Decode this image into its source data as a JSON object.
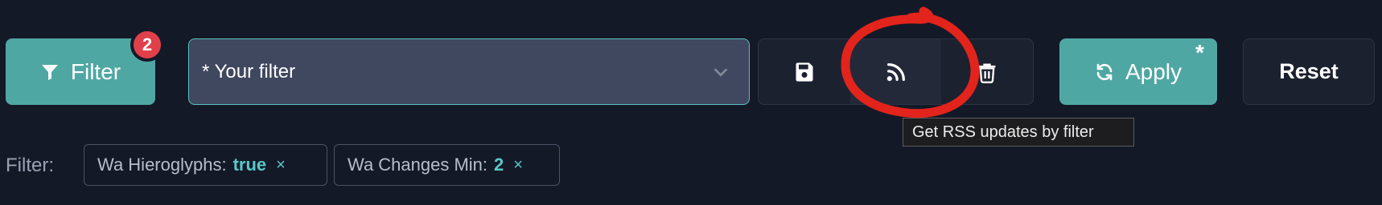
{
  "toolbar": {
    "filter_button": {
      "label": "Filter",
      "icon": "filter-funnel-icon",
      "badge_count": "2"
    },
    "filter_select": {
      "value": "* Your filter",
      "icon": "chevron-down-icon"
    },
    "actions": [
      {
        "name": "save",
        "icon": "floppy-disk-icon"
      },
      {
        "name": "rss",
        "icon": "rss-feed-icon"
      },
      {
        "name": "delete",
        "icon": "trash-icon"
      }
    ],
    "apply_button": {
      "label": "Apply",
      "icon": "refresh-icon",
      "modified_marker": "*"
    },
    "reset_button": {
      "label": "Reset"
    }
  },
  "tooltip": {
    "text": "Get RSS updates by filter"
  },
  "active_filters": {
    "label": "Filter:",
    "chips": [
      {
        "key": "Wa Hieroglyphs:",
        "value": "true",
        "remove": "×"
      },
      {
        "key": "Wa Changes Min:",
        "value": "2",
        "remove": "×"
      }
    ]
  },
  "colors": {
    "background": "#141927",
    "accent_teal": "#4fa7a3",
    "badge_red": "#e0404a",
    "annotation_red": "#e2241c",
    "chip_value": "#59c9c8"
  },
  "annotation": {
    "shape": "hand-drawn red circle around rss button"
  }
}
